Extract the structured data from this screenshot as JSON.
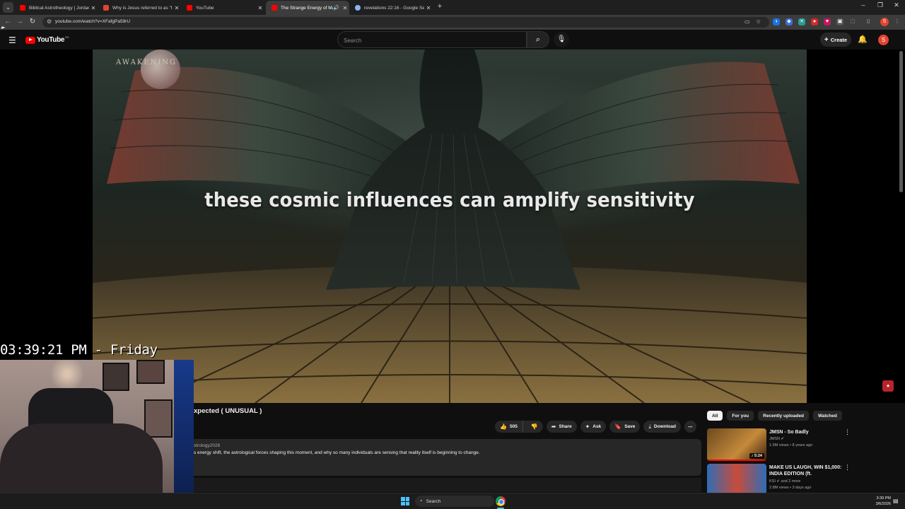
{
  "browser": {
    "tabs": [
      {
        "title": "Biblical Astrotheology | Jordan",
        "favicon_color": "#ff0000",
        "active": false
      },
      {
        "title": "Why is Jesus referred to as \"the",
        "favicon_color": "#e2442f",
        "active": false
      },
      {
        "title": "YouTube",
        "favicon_color": "#ff0000",
        "active": false
      },
      {
        "title": "The Strange Energy of Marc",
        "favicon_color": "#ff0000",
        "active": true,
        "audio": true
      },
      {
        "title": "revelations 22:16 - Google Sea",
        "favicon_color": "#8ab4f8",
        "active": false
      }
    ],
    "new_tab_label": "+",
    "url": "youtube.com/watch?v=XFafgPa59rU",
    "profile_initial": "S"
  },
  "youtube": {
    "logo_text": "YouTube",
    "logo_country": "BD",
    "search_placeholder": "Search",
    "create_label": "Create",
    "avatar_initial": "S"
  },
  "video": {
    "watermark": "AWAKENING",
    "caption": "these cosmic influences can amplify sensitivity",
    "title_fragment": "xpected ( UNUSUAL )",
    "likes": "505",
    "share_label": "Share",
    "ask_label": "Ask",
    "save_label": "Save",
    "download_label": "Download",
    "channel_fragment": "strology2026",
    "description_fragment": "s energy shift, the astrological forces shaping this moment, and why so many individuals are sensing that reality itself is beginning to change."
  },
  "overlay": {
    "clock": "03:39:21 PM - Friday"
  },
  "sidebar": {
    "chips": [
      "All",
      "For you",
      "Recently uploaded",
      "Watched"
    ],
    "active_chip": "All",
    "recommendations": [
      {
        "title": "JMSN - So Badly",
        "channel": "JMSN",
        "meta": "1.5M views • 8 years ago",
        "duration": "5:24",
        "watched_fraction": 1.0,
        "thumb_colors": [
          "#6b4a1e",
          "#c58a3a"
        ]
      },
      {
        "title": "MAKE US LAUGH, WIN $1,000: INDIA EDITION (ft. CarryMinati...",
        "channel": "KSI",
        "channel_extra": "and 2 more",
        "meta": "2.8M views • 3 days ago",
        "thumb_colors": [
          "#2f6db5",
          "#c94b3b"
        ]
      }
    ]
  },
  "taskbar": {
    "search_label": "Search",
    "time": "3:39 PM",
    "date": "3/6/2026"
  },
  "icons": {
    "menu": "hamburger-icon",
    "search": "search-icon",
    "mic": "mic-icon",
    "bell": "bell-icon",
    "like": "thumbs-up-icon",
    "dislike": "thumbs-down-icon",
    "share": "share-icon",
    "ask": "sparkle-icon",
    "save": "bookmark-icon",
    "download": "download-icon"
  }
}
